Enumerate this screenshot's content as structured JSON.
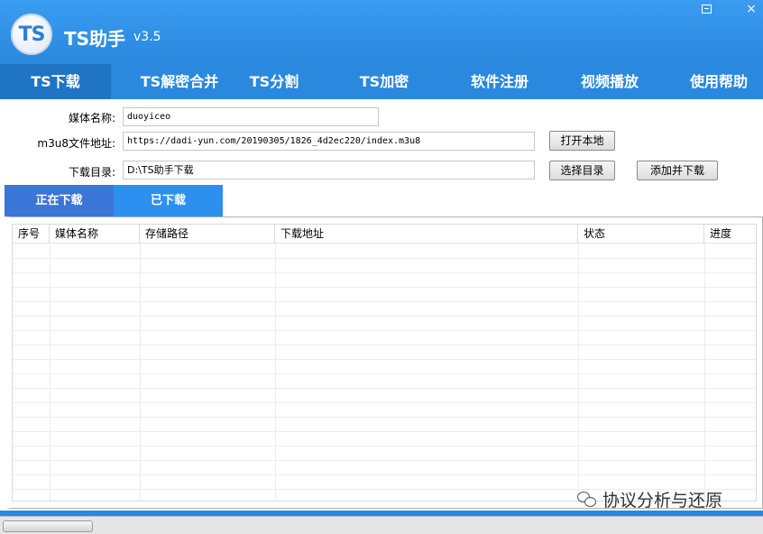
{
  "header": {
    "logo_text": "TS",
    "title": "TS助手",
    "version": "v3.5",
    "min_icon": "minimize-icon",
    "close_icon": "×"
  },
  "nav": {
    "tabs": [
      {
        "label": "TS下载",
        "active": true
      },
      {
        "label": "TS解密合并",
        "active": false
      },
      {
        "label": "TS分割",
        "active": false
      },
      {
        "label": "TS加密",
        "active": false
      },
      {
        "label": "软件注册",
        "active": false
      },
      {
        "label": "视频播放",
        "active": false
      },
      {
        "label": "使用帮助",
        "active": false
      }
    ]
  },
  "form": {
    "media_name_label": "媒体名称:",
    "media_name_value": "duoyiceo",
    "m3u8_label": "m3u8文件地址:",
    "m3u8_value": "https://dadi-yun.com/20190305/1826_4d2ec220/index.m3u8",
    "open_local_button": "打开本地",
    "dir_label": "下载目录:",
    "dir_value": "D:\\TS助手下载",
    "choose_dir_button": "选择目录",
    "add_download_button": "添加并下载"
  },
  "download_tabs": {
    "downloading": "正在下载",
    "downloaded": "已下载"
  },
  "table": {
    "columns": [
      "序号",
      "媒体名称",
      "存储路径",
      "下载地址",
      "状态",
      "进度"
    ]
  },
  "watermark": {
    "text": "协议分析与还原",
    "icon": "wechat-icon"
  },
  "colors": {
    "header_blue": "#2a88df",
    "active_nav": "#1f74c4",
    "downloading_tab": "#3a75d8",
    "downloaded_tab": "#2d8ff0"
  }
}
